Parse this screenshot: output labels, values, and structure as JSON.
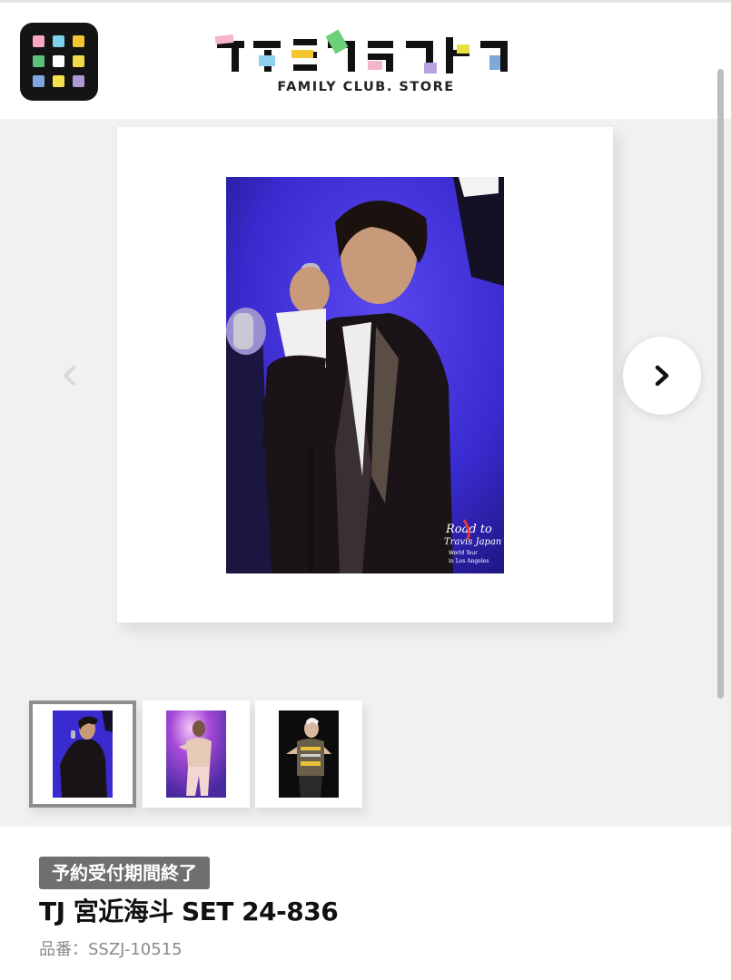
{
  "header": {
    "logo_text": "ファミクラストア",
    "logo_subtitle": "FAMILY CLUB. STORE",
    "menu_icon": "grid-app-icon",
    "menu_colors": [
      "#f7a8c0",
      "#7fd0ea",
      "#f4c431",
      "#5bc07a",
      "#ec5f7f",
      "#f2d94a",
      "#7fa6e0",
      "#f7e14a",
      "#b09ad6"
    ],
    "logo_colors": [
      "#f4b6c8",
      "#8fd0ee",
      "#f4c431",
      "#6ccf7a",
      "#e9e041",
      "#b5a4e0",
      "#7ea9d8"
    ]
  },
  "gallery": {
    "main_image_alt": "ライブで歌う宮近海斗の写真",
    "photo_caption_lines": [
      "Road to",
      "Travis Japan",
      "World Tour",
      "in Los Angeles"
    ],
    "prev_icon": "chevron-left-icon",
    "next_icon": "chevron-right-icon",
    "thumbnails": [
      {
        "alt": "写真1",
        "active": true
      },
      {
        "alt": "写真2",
        "active": false
      },
      {
        "alt": "写真3",
        "active": false
      }
    ]
  },
  "product": {
    "status_badge": "予約受付期間終了",
    "title": "TJ 宮近海斗 SET 24-836",
    "sku": "品番：SSZJ-10515"
  },
  "colors": {
    "badge_bg": "#6f6f6f",
    "gallery_bg": "#f1f1f1",
    "stage_blue": "#3a2bd0"
  }
}
